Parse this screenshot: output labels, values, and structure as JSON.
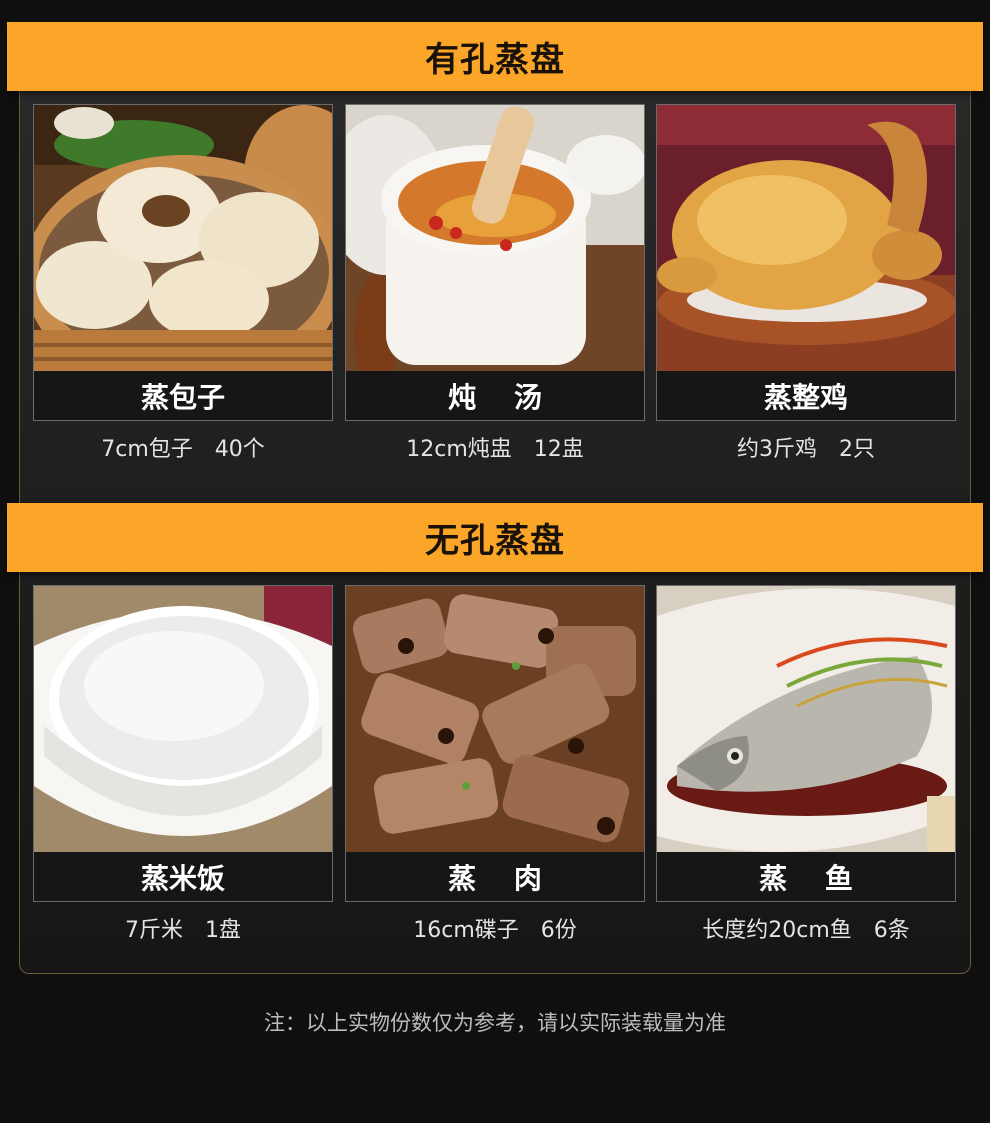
{
  "sections": [
    {
      "title": "有孔蒸盘",
      "items": [
        {
          "name": "蒸包子",
          "caption": "7cm包子　40个",
          "image": "steamed-buns-photo"
        },
        {
          "name": "炖　 汤",
          "caption": "12cm炖盅　12盅",
          "image": "stew-soup-photo"
        },
        {
          "name": "蒸整鸡",
          "caption": "约3斤鸡　2只",
          "image": "whole-chicken-photo"
        }
      ]
    },
    {
      "title": "无孔蒸盘",
      "items": [
        {
          "name": "蒸米饭",
          "caption": "7斤米　1盘",
          "image": "steamed-rice-photo"
        },
        {
          "name": "蒸　 肉",
          "caption": "16cm碟子　6份",
          "image": "steamed-pork-ribs-photo"
        },
        {
          "name": "蒸　 鱼",
          "caption": "长度约20cm鱼　6条",
          "image": "steamed-fish-photo"
        }
      ]
    }
  ],
  "footnote": "注：以上实物份数仅为参考，请以实际装载量为准",
  "colors": {
    "banner": "#fba629",
    "background": "#0f0f0f",
    "panel_border": "#6d5a3a"
  }
}
